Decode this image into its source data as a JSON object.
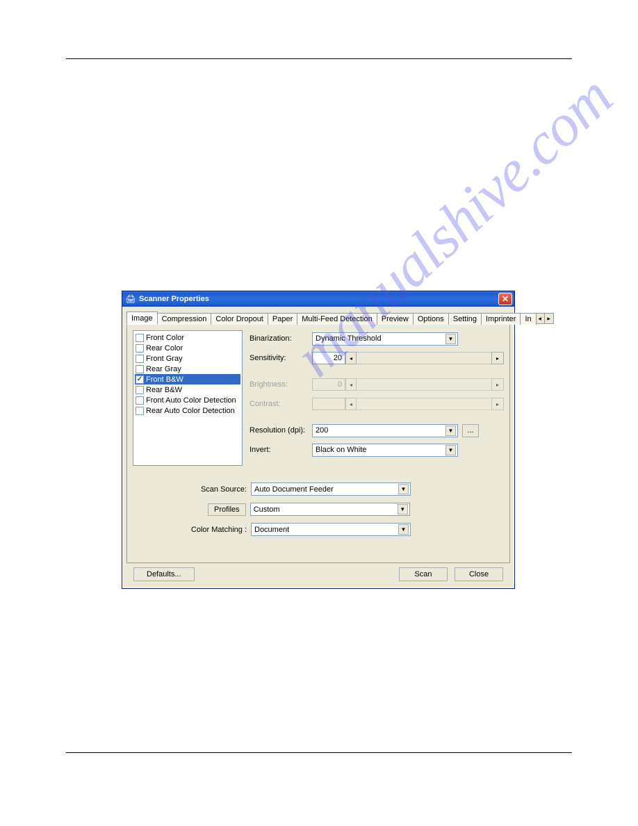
{
  "window": {
    "title": "Scanner Properties"
  },
  "tabs": {
    "items": [
      "Image",
      "Compression",
      "Color Dropout",
      "Paper",
      "Multi-Feed Detection",
      "Preview",
      "Options",
      "Setting",
      "Imprinter",
      "In"
    ],
    "active": 0
  },
  "image_list": {
    "items": [
      {
        "label": "Front Color",
        "checked": false,
        "selected": false
      },
      {
        "label": "Rear Color",
        "checked": false,
        "selected": false
      },
      {
        "label": "Front Gray",
        "checked": false,
        "selected": false
      },
      {
        "label": "Rear Gray",
        "checked": false,
        "selected": false
      },
      {
        "label": "Front B&W",
        "checked": true,
        "selected": true
      },
      {
        "label": "Rear B&W",
        "checked": false,
        "selected": false
      },
      {
        "label": "Front Auto Color Detection",
        "checked": false,
        "selected": false
      },
      {
        "label": "Rear Auto Color Detection",
        "checked": false,
        "selected": false
      }
    ]
  },
  "controls": {
    "binarization": {
      "label": "Binarization:",
      "value": "Dynamic Threshold"
    },
    "sensitivity": {
      "label": "Sensitivity:",
      "value": "20"
    },
    "brightness": {
      "label": "Brightness:",
      "value": "0"
    },
    "contrast": {
      "label": "Contrast:"
    },
    "resolution": {
      "label": "Resolution (dpi):",
      "value": "200",
      "browse": "..."
    },
    "invert": {
      "label": "Invert:",
      "value": "Black on White"
    }
  },
  "lower": {
    "scan_source": {
      "label": "Scan Source:",
      "value": "Auto Document Feeder"
    },
    "profiles": {
      "label": "Profiles",
      "value": "Custom"
    },
    "color_matching": {
      "label": "Color Matching :",
      "value": "Document"
    }
  },
  "buttons": {
    "defaults": "Defaults...",
    "scan": "Scan",
    "close": "Close"
  },
  "watermark": "manualshive.com"
}
